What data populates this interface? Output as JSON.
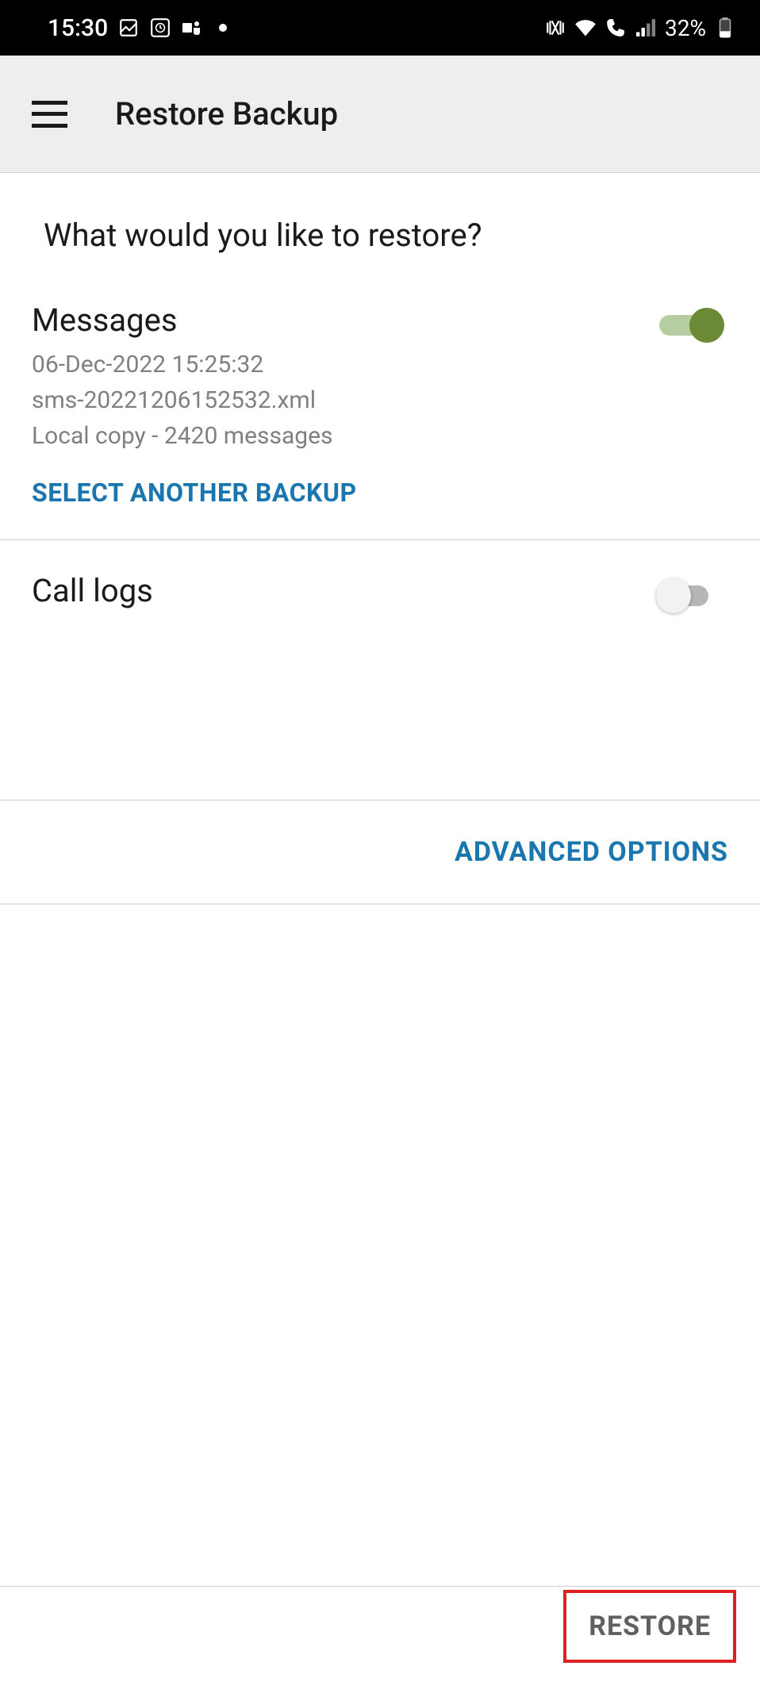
{
  "statusbar": {
    "time": "15:30",
    "battery": "32%"
  },
  "appbar": {
    "title": "Restore Backup"
  },
  "heading": "What would you like to restore?",
  "messages": {
    "title": "Messages",
    "datetime": "06-Dec-2022 15:25:32",
    "filename": "sms-20221206152532.xml",
    "details": "Local copy - 2420 messages",
    "select_link": "SELECT ANOTHER BACKUP",
    "toggle_on": true
  },
  "calllogs": {
    "title": "Call logs",
    "toggle_on": false
  },
  "advanced": {
    "label": "ADVANCED OPTIONS"
  },
  "footer": {
    "restore_label": "RESTORE"
  }
}
